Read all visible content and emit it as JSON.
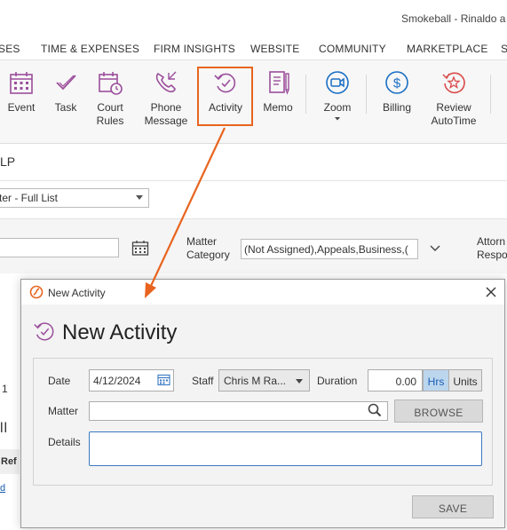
{
  "window": {
    "title": "Smokeball - Rinaldo a"
  },
  "menu": {
    "items": [
      "SES",
      "TIME & EXPENSES",
      "FIRM INSIGHTS",
      "WEBSITE",
      "COMMUNITY",
      "MARKETPLACE",
      "S"
    ]
  },
  "ribbon": {
    "event": "Event",
    "task": "Task",
    "court_rules": [
      "Court",
      "Rules"
    ],
    "phone_message": [
      "Phone",
      "Message"
    ],
    "activity": "Activity",
    "memo": "Memo",
    "zoom": "Zoom",
    "billing": "Billing",
    "review_autotime": [
      "Review",
      "AutoTime"
    ],
    "accent": "#e8641e",
    "icon_color": "#9b4f9b",
    "blue_icon_color": "#1a6fc4",
    "red_icon_color": "#d94b4b"
  },
  "background": {
    "firm_label": "LP",
    "list_filter": "ter - Full List",
    "matter_category_label": [
      "Matter",
      "Category"
    ],
    "matter_category_value": "(Not Assigned),Appeals,Business,(",
    "attorney_label": [
      "Attorn",
      "Respo"
    ],
    "grid_value_1": "1",
    "grid_bars": "ll",
    "ref_header": "Ref",
    "grid_link": "d"
  },
  "dialog": {
    "title": "New Activity",
    "heading": "New Activity",
    "date_label": "Date",
    "date_value": "4/12/2024",
    "staff_label": "Staff",
    "staff_value": "Chris M Ra...",
    "duration_label": "Duration",
    "duration_value": "0.00",
    "hrs": "Hrs",
    "units": "Units",
    "matter_label": "Matter",
    "matter_value": "",
    "browse": "BROWSE",
    "details_label": "Details",
    "details_value": "",
    "save": "SAVE",
    "logo_color": "#e8641e",
    "selected_unit_color": "#bcd6ee"
  }
}
